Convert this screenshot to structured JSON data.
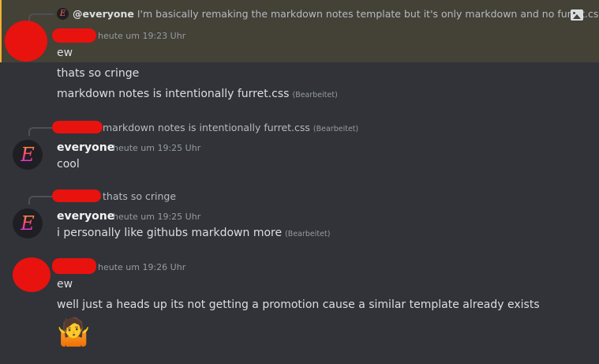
{
  "messages": [
    {
      "reply": {
        "mention": "@everyone",
        "text": "I'm basically remaking the markdown notes template but it's only markdown and no furret.css",
        "icon": "image-icon"
      },
      "timestamp": "heute um 19:23 Uhr",
      "lines": [
        {
          "text": "ew"
        },
        {
          "text": "thats so cringe"
        },
        {
          "text": "markdown notes is intentionally furret.css",
          "edited": "(Bearbeitet)"
        }
      ],
      "highlighted": true
    },
    {
      "reply": {
        "text": "markdown notes is intentionally furret.css",
        "edited": "(Bearbeitet)"
      },
      "username": "everyone",
      "timestamp": "heute um 19:25 Uhr",
      "lines": [
        {
          "text": "cool"
        }
      ]
    },
    {
      "reply": {
        "text": "thats so cringe"
      },
      "username": "everyone",
      "timestamp": "heute um 19:25 Uhr",
      "lines": [
        {
          "text": "i personally like githubs markdown more",
          "edited": "(Bearbeitet)"
        }
      ]
    },
    {
      "timestamp": "heute um 19:26 Uhr",
      "lines": [
        {
          "text": "ew"
        },
        {
          "text": "well just a heads up its not getting a promotion cause a similar template already exists"
        }
      ],
      "reaction_emoji": "🤷",
      "emoji_name": "person-shrugging-emoji"
    }
  ],
  "colors": {
    "background": "#313338",
    "highlight": "#444137",
    "highlight_bar": "#f0b232",
    "redaction": "#e8120f"
  }
}
